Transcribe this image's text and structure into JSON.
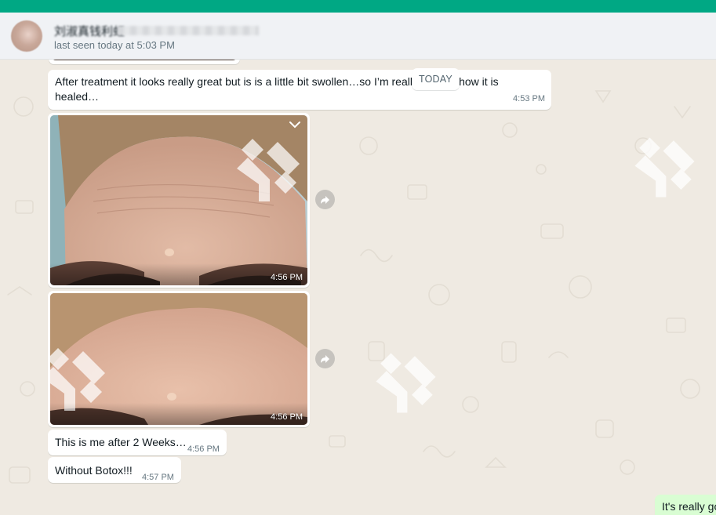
{
  "app": {
    "accent_color": "#00a884"
  },
  "header": {
    "contact_name": "刘淑真钱利虹",
    "last_seen": "last seen today at 5:03 PM"
  },
  "date_chip": "TODAY",
  "messages": [
    {
      "text": "After treatment it looks really great but is is a little bit swollen…so I’m really excited how it is healed…",
      "time": "4:53 PM"
    },
    {
      "image": "forehead-photo-before",
      "time": "4:56 PM"
    },
    {
      "image": "forehead-photo-after",
      "time": "4:56 PM"
    },
    {
      "text": "This is me after 2 Weeks…",
      "time": "4:56 PM"
    },
    {
      "text": "Without Botox!!!",
      "time": "4:57 PM"
    }
  ],
  "outgoing": {
    "text": "It's really go"
  },
  "icons": {
    "menu": "chevron-down-icon",
    "forward": "forward-arrow-icon"
  }
}
